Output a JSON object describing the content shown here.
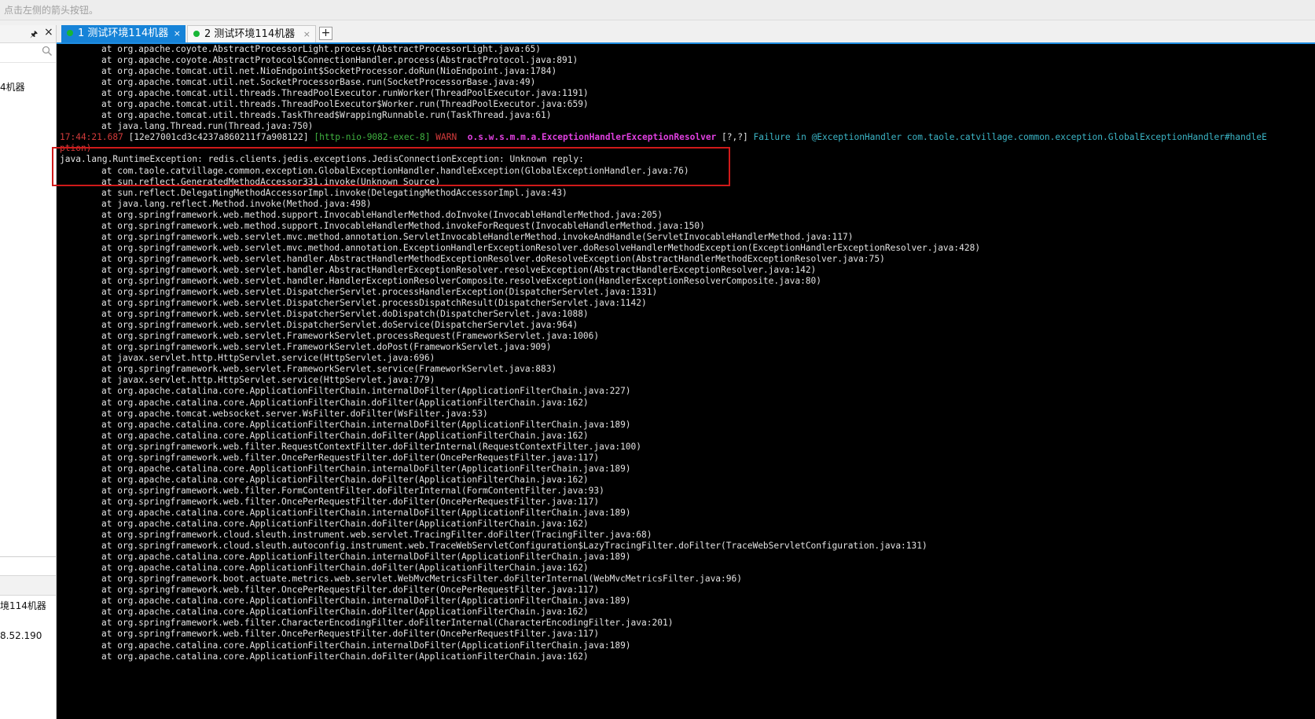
{
  "hint_text": "点击左侧的箭头按钮。",
  "sidebar": {
    "pin_icon": "pin-icon",
    "close_icon": "close-icon",
    "search_icon": "search-icon",
    "item1": "4机器",
    "item2": "境114机器",
    "item3": "8.52.190"
  },
  "tabs": [
    {
      "label": "1 测试环境114机器",
      "close": "×",
      "status_color": "#17b636"
    },
    {
      "label": "2 测试环境114机器",
      "close": "×",
      "status_color": "#17b636"
    }
  ],
  "tab_add_label": "+",
  "colors": {
    "accent": "#1683d8",
    "terminal_bg": "#000000",
    "highlight_border": "#d01a1a"
  },
  "terminal": {
    "lines_top": [
      "at org.apache.coyote.AbstractProcessorLight.process(AbstractProcessorLight.java:65)",
      "at org.apache.coyote.AbstractProtocol$ConnectionHandler.process(AbstractProtocol.java:891)",
      "at org.apache.tomcat.util.net.NioEndpoint$SocketProcessor.doRun(NioEndpoint.java:1784)",
      "at org.apache.tomcat.util.net.SocketProcessorBase.run(SocketProcessorBase.java:49)",
      "at org.apache.tomcat.util.threads.ThreadPoolExecutor.runWorker(ThreadPoolExecutor.java:1191)",
      "at org.apache.tomcat.util.threads.ThreadPoolExecutor$Worker.run(ThreadPoolExecutor.java:659)",
      "at org.apache.tomcat.util.threads.TaskThread$WrappingRunnable.run(TaskThread.java:61)",
      "at java.lang.Thread.run(Thread.java:750)"
    ],
    "warn": {
      "time": "17:44:21.687",
      "trace": "[12e27001cd3c4237a860211f7a908122]",
      "thread": "[http-nio-9082-exec-8]",
      "level": "WARN",
      "logger": "o.s.w.s.m.m.a.ExceptionHandlerExceptionResolver",
      "marker": "[?,?]",
      "message": "Failure in @ExceptionHandler com.taole.catvillage.common.exception.GlobalExceptionHandler#handleE",
      "continuation": "ption)"
    },
    "exception": "java.lang.RuntimeException: redis.clients.jedis.exceptions.JedisConnectionException: Unknown reply:",
    "lines_bottom": [
      "at com.taole.catvillage.common.exception.GlobalExceptionHandler.handleException(GlobalExceptionHandler.java:76)",
      "at sun.reflect.GeneratedMethodAccessor331.invoke(Unknown Source)",
      "at sun.reflect.DelegatingMethodAccessorImpl.invoke(DelegatingMethodAccessorImpl.java:43)",
      "at java.lang.reflect.Method.invoke(Method.java:498)",
      "at org.springframework.web.method.support.InvocableHandlerMethod.doInvoke(InvocableHandlerMethod.java:205)",
      "at org.springframework.web.method.support.InvocableHandlerMethod.invokeForRequest(InvocableHandlerMethod.java:150)",
      "at org.springframework.web.servlet.mvc.method.annotation.ServletInvocableHandlerMethod.invokeAndHandle(ServletInvocableHandlerMethod.java:117)",
      "at org.springframework.web.servlet.mvc.method.annotation.ExceptionHandlerExceptionResolver.doResolveHandlerMethodException(ExceptionHandlerExceptionResolver.java:428)",
      "at org.springframework.web.servlet.handler.AbstractHandlerMethodExceptionResolver.doResolveException(AbstractHandlerMethodExceptionResolver.java:75)",
      "at org.springframework.web.servlet.handler.AbstractHandlerExceptionResolver.resolveException(AbstractHandlerExceptionResolver.java:142)",
      "at org.springframework.web.servlet.handler.HandlerExceptionResolverComposite.resolveException(HandlerExceptionResolverComposite.java:80)",
      "at org.springframework.web.servlet.DispatcherServlet.processHandlerException(DispatcherServlet.java:1331)",
      "at org.springframework.web.servlet.DispatcherServlet.processDispatchResult(DispatcherServlet.java:1142)",
      "at org.springframework.web.servlet.DispatcherServlet.doDispatch(DispatcherServlet.java:1088)",
      "at org.springframework.web.servlet.DispatcherServlet.doService(DispatcherServlet.java:964)",
      "at org.springframework.web.servlet.FrameworkServlet.processRequest(FrameworkServlet.java:1006)",
      "at org.springframework.web.servlet.FrameworkServlet.doPost(FrameworkServlet.java:909)",
      "at javax.servlet.http.HttpServlet.service(HttpServlet.java:696)",
      "at org.springframework.web.servlet.FrameworkServlet.service(FrameworkServlet.java:883)",
      "at javax.servlet.http.HttpServlet.service(HttpServlet.java:779)",
      "at org.apache.catalina.core.ApplicationFilterChain.internalDoFilter(ApplicationFilterChain.java:227)",
      "at org.apache.catalina.core.ApplicationFilterChain.doFilter(ApplicationFilterChain.java:162)",
      "at org.apache.tomcat.websocket.server.WsFilter.doFilter(WsFilter.java:53)",
      "at org.apache.catalina.core.ApplicationFilterChain.internalDoFilter(ApplicationFilterChain.java:189)",
      "at org.apache.catalina.core.ApplicationFilterChain.doFilter(ApplicationFilterChain.java:162)",
      "at org.springframework.web.filter.RequestContextFilter.doFilterInternal(RequestContextFilter.java:100)",
      "at org.springframework.web.filter.OncePerRequestFilter.doFilter(OncePerRequestFilter.java:117)",
      "at org.apache.catalina.core.ApplicationFilterChain.internalDoFilter(ApplicationFilterChain.java:189)",
      "at org.apache.catalina.core.ApplicationFilterChain.doFilter(ApplicationFilterChain.java:162)",
      "at org.springframework.web.filter.FormContentFilter.doFilterInternal(FormContentFilter.java:93)",
      "at org.springframework.web.filter.OncePerRequestFilter.doFilter(OncePerRequestFilter.java:117)",
      "at org.apache.catalina.core.ApplicationFilterChain.internalDoFilter(ApplicationFilterChain.java:189)",
      "at org.apache.catalina.core.ApplicationFilterChain.doFilter(ApplicationFilterChain.java:162)",
      "at org.springframework.cloud.sleuth.instrument.web.servlet.TracingFilter.doFilter(TracingFilter.java:68)",
      "at org.springframework.cloud.sleuth.autoconfig.instrument.web.TraceWebServletConfiguration$LazyTracingFilter.doFilter(TraceWebServletConfiguration.java:131)",
      "at org.apache.catalina.core.ApplicationFilterChain.internalDoFilter(ApplicationFilterChain.java:189)",
      "at org.apache.catalina.core.ApplicationFilterChain.doFilter(ApplicationFilterChain.java:162)",
      "at org.springframework.boot.actuate.metrics.web.servlet.WebMvcMetricsFilter.doFilterInternal(WebMvcMetricsFilter.java:96)",
      "at org.springframework.web.filter.OncePerRequestFilter.doFilter(OncePerRequestFilter.java:117)",
      "at org.apache.catalina.core.ApplicationFilterChain.internalDoFilter(ApplicationFilterChain.java:189)",
      "at org.apache.catalina.core.ApplicationFilterChain.doFilter(ApplicationFilterChain.java:162)",
      "at org.springframework.web.filter.CharacterEncodingFilter.doFilterInternal(CharacterEncodingFilter.java:201)",
      "at org.springframework.web.filter.OncePerRequestFilter.doFilter(OncePerRequestFilter.java:117)",
      "at org.apache.catalina.core.ApplicationFilterChain.internalDoFilter(ApplicationFilterChain.java:189)",
      "at org.apache.catalina.core.ApplicationFilterChain.doFilter(ApplicationFilterChain.java:162)"
    ]
  }
}
